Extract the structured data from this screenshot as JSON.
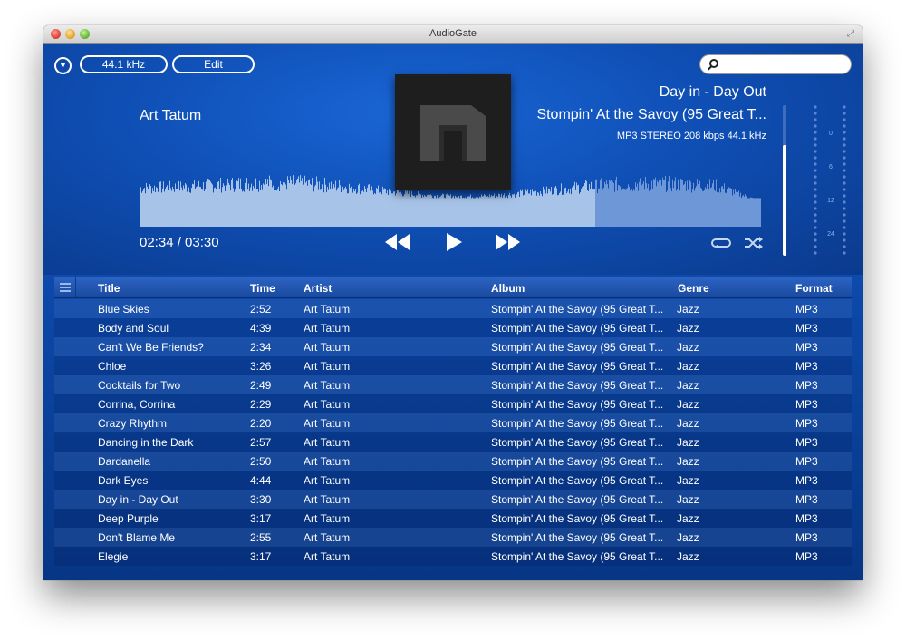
{
  "window": {
    "title": "AudioGate"
  },
  "toolbar": {
    "sample_rate": "44.1 kHz",
    "edit_label": "Edit",
    "search_placeholder": ""
  },
  "now_playing": {
    "artist": "Art Tatum",
    "track": "Day in - Day Out",
    "album": "Stompin' At the Savoy (95 Great T...",
    "format_info": "MP3 STEREO 208 kbps 44.1 kHz",
    "elapsed": "02:34",
    "total": "03:30",
    "time_display": "02:34 / 03:30",
    "progress_fraction": 0.733
  },
  "meter_scale": [
    "0",
    "6",
    "12",
    "24"
  ],
  "icons": {
    "dropdown": "chevron-down-icon",
    "search": "search-icon",
    "rewind": "rewind-icon",
    "play": "play-icon",
    "fast_forward": "fast-forward-icon",
    "repeat": "repeat-icon",
    "shuffle": "shuffle-icon",
    "menu": "menu-icon"
  },
  "colors": {
    "background": "#0a3a8c",
    "accent": "#1a66d6",
    "waveform_played": "#a7c4e8",
    "waveform_unplayed": "#6d97d6"
  },
  "table": {
    "columns": [
      "Title",
      "Time",
      "Artist",
      "Album",
      "Genre",
      "Format"
    ],
    "rows": [
      [
        "Blue Skies",
        "2:52",
        "Art Tatum",
        "Stompin' At the Savoy (95 Great T...",
        "Jazz",
        "MP3"
      ],
      [
        "Body and Soul",
        "4:39",
        "Art Tatum",
        "Stompin' At the Savoy (95 Great T...",
        "Jazz",
        "MP3"
      ],
      [
        "Can't We Be Friends?",
        "2:34",
        "Art Tatum",
        "Stompin' At the Savoy (95 Great T...",
        "Jazz",
        "MP3"
      ],
      [
        "Chloe",
        "3:26",
        "Art Tatum",
        "Stompin' At the Savoy (95 Great T...",
        "Jazz",
        "MP3"
      ],
      [
        "Cocktails for Two",
        "2:49",
        "Art Tatum",
        "Stompin' At the Savoy (95 Great T...",
        "Jazz",
        "MP3"
      ],
      [
        "Corrina, Corrina",
        "2:29",
        "Art Tatum",
        "Stompin' At the Savoy (95 Great T...",
        "Jazz",
        "MP3"
      ],
      [
        "Crazy Rhythm",
        "2:20",
        "Art Tatum",
        "Stompin' At the Savoy (95 Great T...",
        "Jazz",
        "MP3"
      ],
      [
        "Dancing in the Dark",
        "2:57",
        "Art Tatum",
        "Stompin' At the Savoy (95 Great T...",
        "Jazz",
        "MP3"
      ],
      [
        "Dardanella",
        "2:50",
        "Art Tatum",
        "Stompin' At the Savoy (95 Great T...",
        "Jazz",
        "MP3"
      ],
      [
        "Dark Eyes",
        "4:44",
        "Art Tatum",
        "Stompin' At the Savoy (95 Great T...",
        "Jazz",
        "MP3"
      ],
      [
        "Day in - Day Out",
        "3:30",
        "Art Tatum",
        "Stompin' At the Savoy (95 Great T...",
        "Jazz",
        "MP3"
      ],
      [
        "Deep Purple",
        "3:17",
        "Art Tatum",
        "Stompin' At the Savoy (95 Great T...",
        "Jazz",
        "MP3"
      ],
      [
        "Don't Blame Me",
        "2:55",
        "Art Tatum",
        "Stompin' At the Savoy (95 Great T...",
        "Jazz",
        "MP3"
      ],
      [
        "Elegie",
        "3:17",
        "Art Tatum",
        "Stompin' At the Savoy (95 Great T...",
        "Jazz",
        "MP3"
      ]
    ]
  }
}
